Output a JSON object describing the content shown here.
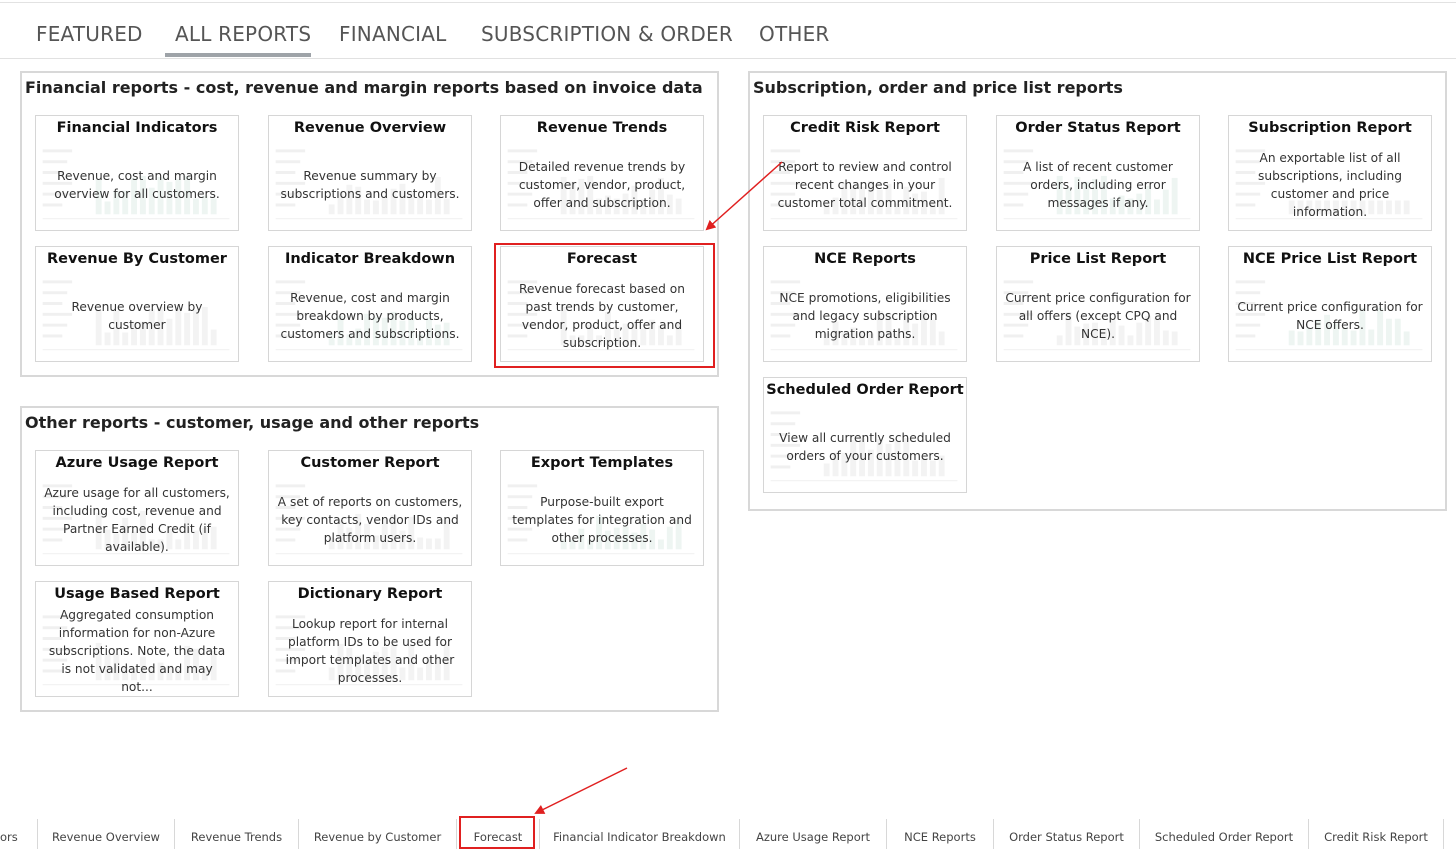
{
  "top_tabs": [
    {
      "label": "FEATURED"
    },
    {
      "label": "ALL REPORTS",
      "active": true
    },
    {
      "label": "FINANCIAL"
    },
    {
      "label": "SUBSCRIPTION & ORDER"
    },
    {
      "label": "OTHER"
    }
  ],
  "sections": {
    "financial": {
      "title": "Financial reports - cost, revenue and margin reports based on invoice data",
      "cards": [
        {
          "title": "Financial Indicators",
          "desc": "Revenue, cost and margin overview for all customers."
        },
        {
          "title": "Revenue Overview",
          "desc": "Revenue summary by subscriptions and customers."
        },
        {
          "title": "Revenue Trends",
          "desc": "Detailed revenue trends by customer, vendor, product, offer and subscription."
        },
        {
          "title": "Revenue By Customer",
          "desc": "Revenue overview by customer"
        },
        {
          "title": "Indicator Breakdown",
          "desc": "Revenue, cost and margin breakdown by products, customers and subscriptions."
        },
        {
          "title": "Forecast",
          "desc": "Revenue forecast based on past trends by customer, vendor, product, offer and subscription."
        }
      ]
    },
    "subscription": {
      "title": "Subscription, order and price list reports",
      "cards": [
        {
          "title": "Credit Risk Report",
          "desc": "Report to review and control recent changes in your customer total commitment."
        },
        {
          "title": "Order Status Report",
          "desc": "A list of recent customer orders, including error messages if any."
        },
        {
          "title": "Subscription Report",
          "desc": "An exportable list of all subscriptions, including customer and price information."
        },
        {
          "title": "NCE Reports",
          "desc": "NCE promotions, eligibilities and legacy subscription migration paths."
        },
        {
          "title": "Price List Report",
          "desc": "Current price configuration for all offers (except CPQ and NCE)."
        },
        {
          "title": "NCE Price List Report",
          "desc": "Current price configuration for NCE offers."
        },
        {
          "title": "Scheduled Order Report",
          "desc": "View all currently scheduled orders of your customers."
        }
      ]
    },
    "other": {
      "title": "Other reports - customer, usage and other reports",
      "cards": [
        {
          "title": "Azure Usage Report",
          "desc": "Azure usage for all customers, including cost, revenue and Partner Earned Credit (if available)."
        },
        {
          "title": "Customer Report",
          "desc": "A set of reports on customers, key contacts, vendor IDs and platform users."
        },
        {
          "title": "Export Templates",
          "desc": "Purpose-built export templates for integration and other processes."
        },
        {
          "title": "Usage Based Report",
          "desc": "Aggregated consumption information for non-Azure subscriptions. Note, the data is not validated and may not..."
        },
        {
          "title": "Dictionary Report",
          "desc": "Lookup report for internal platform IDs to be used for import templates and other processes."
        }
      ]
    }
  },
  "bottom_tabs": [
    {
      "label": "ors"
    },
    {
      "label": "Revenue Overview"
    },
    {
      "label": "Revenue Trends"
    },
    {
      "label": "Revenue by Customer"
    },
    {
      "label": "Forecast",
      "highlighted": true
    },
    {
      "label": "Financial Indicator Breakdown"
    },
    {
      "label": "Azure Usage Report"
    },
    {
      "label": "NCE Reports"
    },
    {
      "label": "Order Status Report"
    },
    {
      "label": "Scheduled Order Report"
    },
    {
      "label": "Credit Risk Report"
    }
  ],
  "colors": {
    "highlight": "#e02020",
    "border": "#d8d8d8",
    "tab_underline": "#9ea3a8"
  }
}
